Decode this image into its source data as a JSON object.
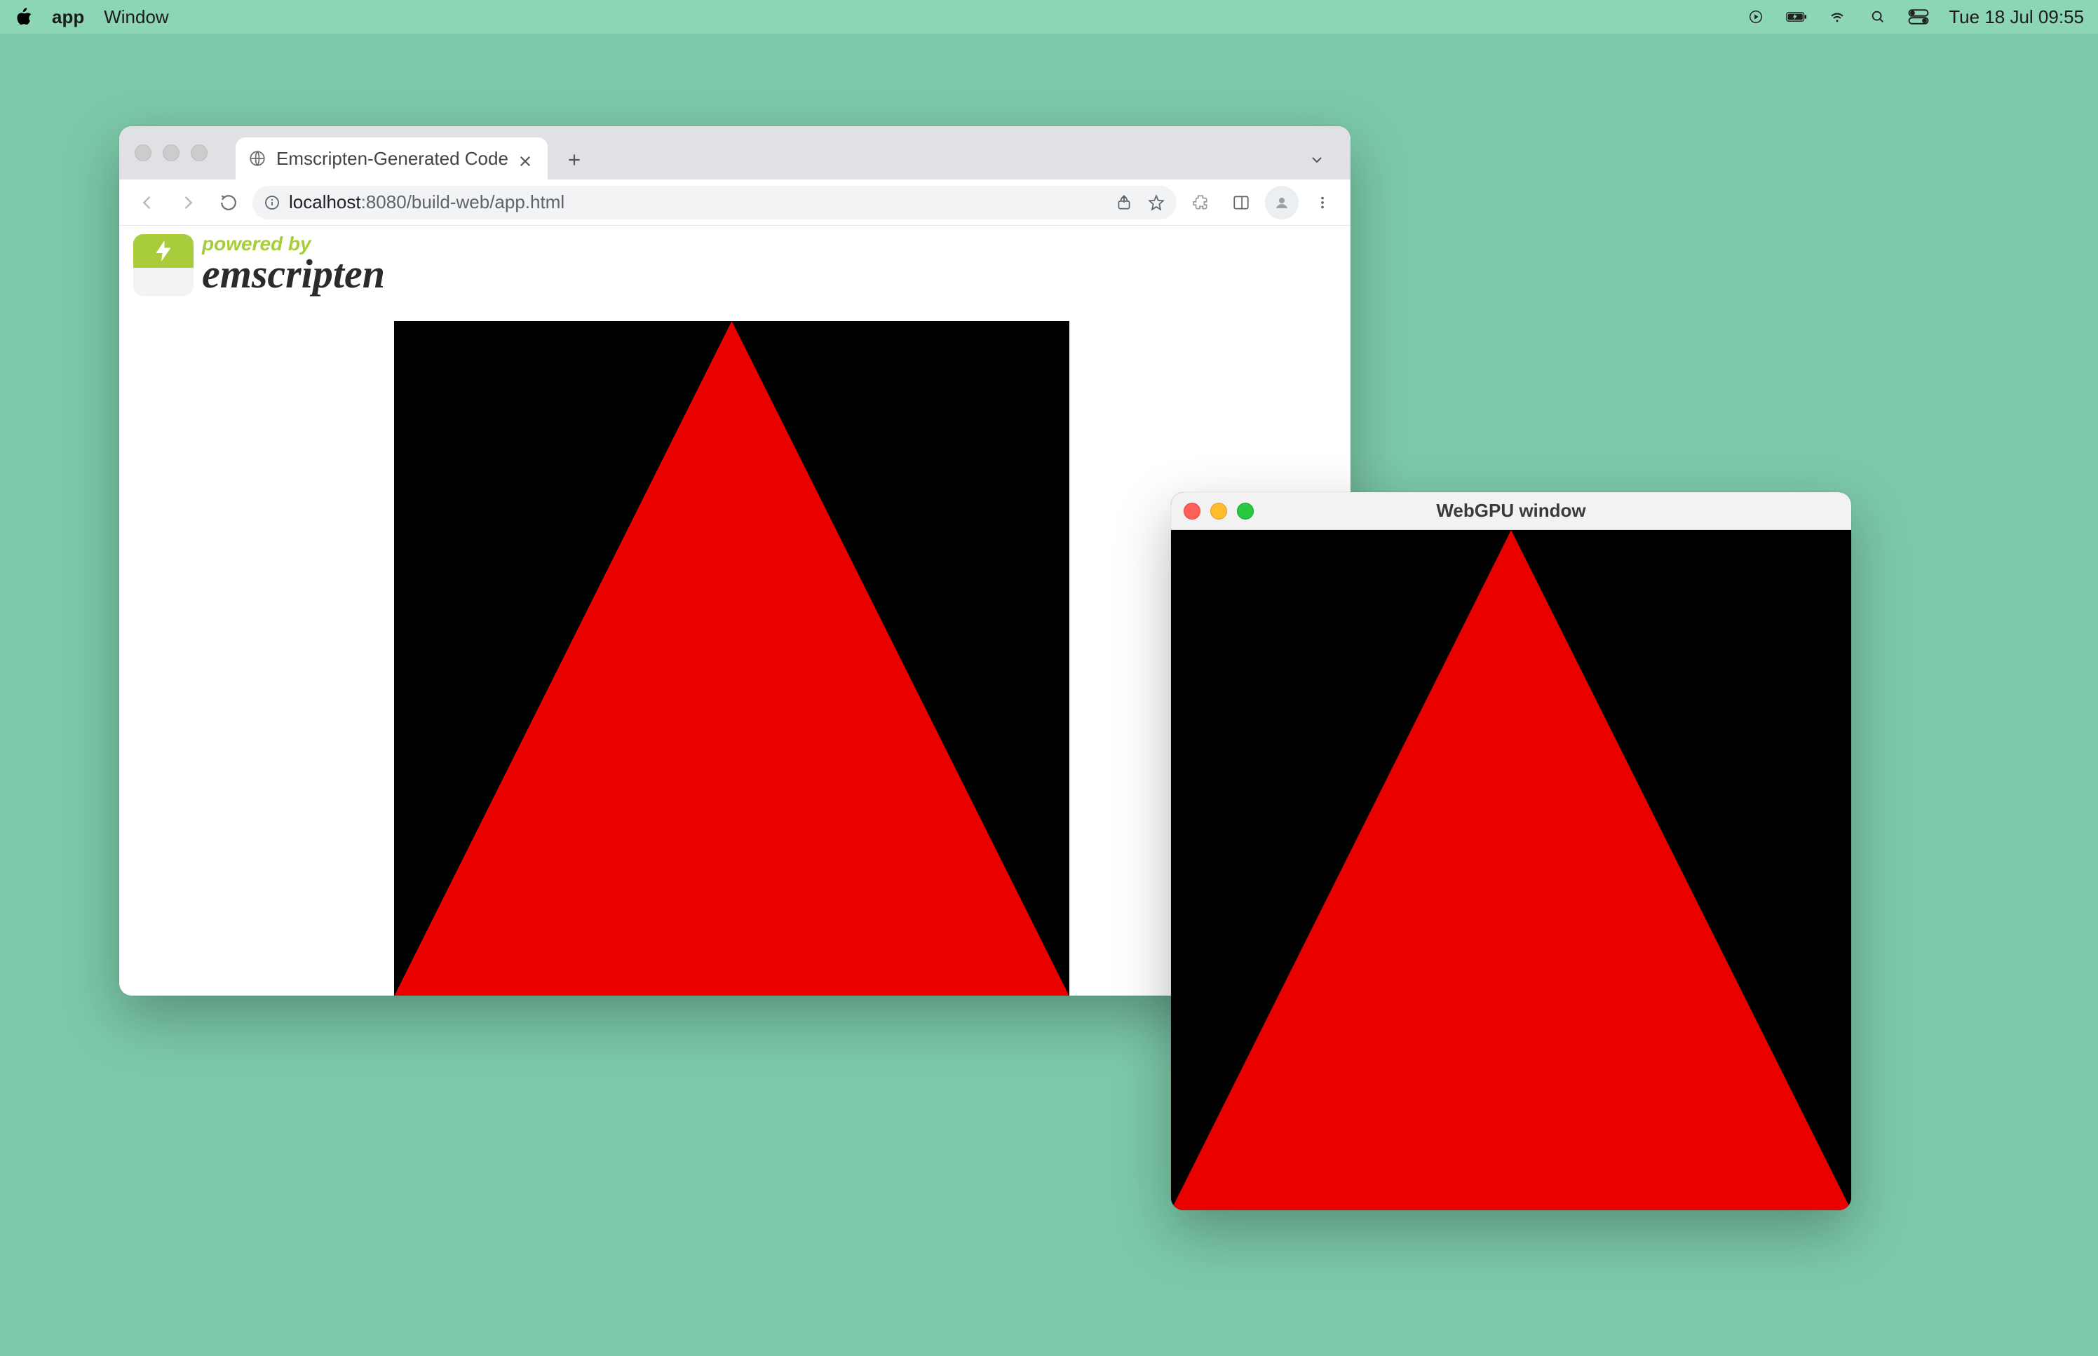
{
  "menubar": {
    "app": "app",
    "menu_window": "Window",
    "clock": "Tue 18 Jul  09:55"
  },
  "browser": {
    "tab_title": "Emscripten-Generated Code",
    "url_host": "localhost",
    "url_port_path": ":8080/build-web/app.html",
    "emscripten": {
      "powered_by": "powered by",
      "name": "emscripten"
    }
  },
  "native_window": {
    "title": "WebGPU window"
  },
  "colors": {
    "desktop": "#7cc9a9",
    "canvas_bg": "#000000",
    "triangle": "#eb0000"
  }
}
